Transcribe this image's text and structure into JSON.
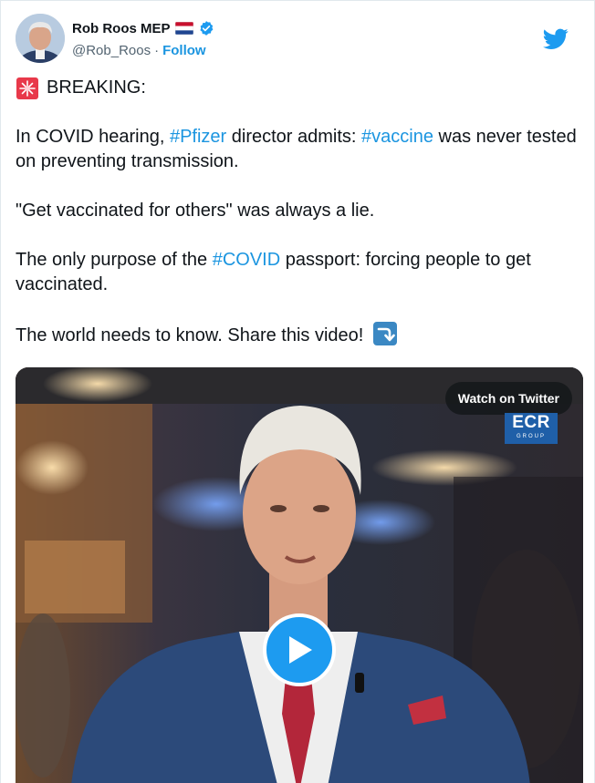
{
  "author": {
    "display_name": "Rob Roos MEP",
    "handle": "@Rob_Roos",
    "separator": "·",
    "follow_label": "Follow",
    "flag_icon": "netherlands-flag",
    "verified_icon": "verified-badge-icon"
  },
  "logo": {
    "icon": "twitter-bird-icon",
    "color": "#1d9bf0"
  },
  "tweet": {
    "p1_text": "BREAKING:",
    "p1_icon": "police-siren-icon",
    "p2_part1": "In COVID hearing, ",
    "p2_tag1": "#Pfizer",
    "p2_part2": " director admits: ",
    "p2_tag2": "#vaccine",
    "p2_part3": " was never tested on preventing transmission.",
    "p3_text": "\"Get vaccinated for others\" was always a lie.",
    "p4_part1": "The only purpose of the ",
    "p4_tag": "#COVID",
    "p4_part2": " passport: forcing people to get vaccinated.",
    "p5_text": "The world needs to know. Share this video! ",
    "p5_icon": "right-arrow-curving-down-icon"
  },
  "media": {
    "watch_label": "Watch on Twitter",
    "logo_main": "ECR",
    "logo_sub": "GROUP",
    "play_icon": "play-icon"
  },
  "colors": {
    "hashtag": "#1b95e0",
    "play_button": "#1d9bf0",
    "ecr_badge": "#1f5fa8",
    "text": "#0f1419",
    "muted": "#536471"
  }
}
